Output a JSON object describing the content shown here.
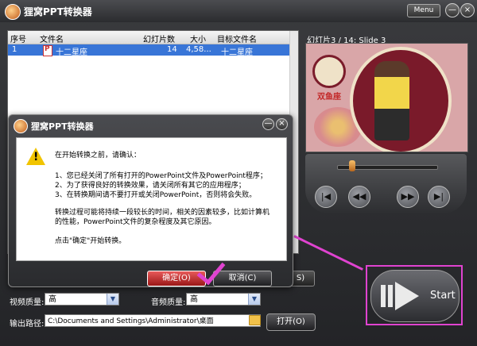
{
  "app": {
    "title": "狸窝PPT转换器",
    "menu_label": "Menu",
    "min_label": "—",
    "close_label": "×"
  },
  "file_list": {
    "columns": [
      "序号",
      "文件名",
      "幻灯片数",
      "大小",
      "目标文件名"
    ],
    "rows": [
      {
        "index": "1",
        "name": "十二星座",
        "slides": "14",
        "size": "4,58...",
        "target": "十二星座"
      }
    ]
  },
  "preview": {
    "label": "幻灯片3 / 14: Slide 3",
    "slide_caption": "双鱼座"
  },
  "player": {
    "buttons": [
      "|◀",
      "◀◀",
      "▶▶",
      "▶|"
    ],
    "progress_fraction": 0.12
  },
  "output": {
    "format_btn_label": "S)",
    "video_quality_label": "视频质量:",
    "video_quality_value": "高",
    "audio_quality_label": "音频质量:",
    "audio_quality_value": "高",
    "path_label": "输出路径:",
    "path_value": "C:\\Documents and Settings\\Administrator\\桌面",
    "open_label": "打开(O)"
  },
  "start": {
    "label": "Start"
  },
  "dialog": {
    "title": "狸窝PPT转换器",
    "lines": [
      "在开始转换之前，请确认：",
      "1、您已经关闭了所有打开的PowerPoint文件及PowerPoint程序；",
      "2、为了获得良好的转换效果，请关闭所有其它的应用程序；",
      "3、在转换期间请不要打开或关闭PowerPoint，否则将会失败。",
      "转换过程可能将持续一段较长的时间，相关的因素较多，比如计算机",
      "的性能，PowerPoint文件的复杂程度及其它原因。",
      "点击\"确定\"开始转换。"
    ],
    "ok_label": "确定(O)",
    "cancel_label": "取消(C)"
  },
  "colors": {
    "highlight": "#3875d7",
    "annotation": "#e043d0",
    "ok_button": "#c62828"
  }
}
